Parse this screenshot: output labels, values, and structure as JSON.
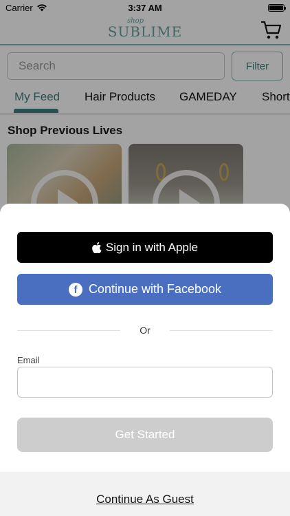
{
  "status_bar": {
    "carrier": "Carrier",
    "time": "3:37 AM"
  },
  "header": {
    "logo_small": "shop",
    "logo_main": "SUBLIME"
  },
  "search": {
    "placeholder": "Search",
    "filter_label": "Filter"
  },
  "tabs": [
    {
      "label": "My Feed",
      "active": true
    },
    {
      "label": "Hair Products",
      "active": false
    },
    {
      "label": "GAMEDAY",
      "active": false
    },
    {
      "label": "Shorts",
      "active": false
    }
  ],
  "section": {
    "title": "Shop Previous Lives"
  },
  "sheet": {
    "apple_label": "Sign in with Apple",
    "facebook_label": "Continue with Facebook",
    "or_label": "Or",
    "email_label": "Email",
    "email_value": "",
    "get_started_label": "Get Started",
    "guest_label": "Continue As Guest"
  },
  "colors": {
    "accent": "#3e7f7e",
    "facebook": "#4a6fc0",
    "disabled_button": "#cdcdcd"
  }
}
